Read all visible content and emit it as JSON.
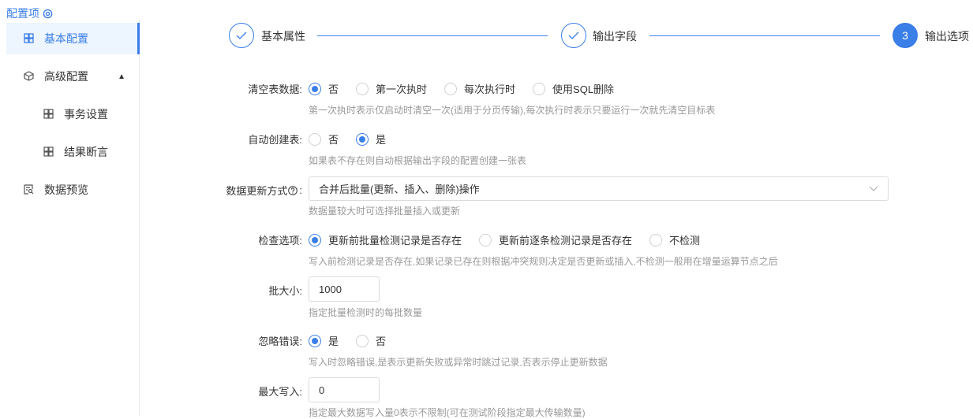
{
  "sidebar": {
    "title": "配置项",
    "items": [
      {
        "label": "基本配置",
        "icon": "grid-icon"
      },
      {
        "label": "高级配置",
        "icon": "cube-icon"
      },
      {
        "label": "事务设置",
        "icon": "grid-icon"
      },
      {
        "label": "结果断言",
        "icon": "grid-icon"
      },
      {
        "label": "数据预览",
        "icon": "preview-icon"
      }
    ]
  },
  "steps": [
    {
      "label": "基本属性",
      "status": "done"
    },
    {
      "label": "输出字段",
      "status": "done"
    },
    {
      "label": "输出选项",
      "number": "3",
      "status": "current"
    }
  ],
  "form": {
    "clear": {
      "label": "清空表数据:",
      "options": [
        "否",
        "第一次执时",
        "每次执行时",
        "使用SQL删除"
      ],
      "selected": 0,
      "hint": "第一次执时表示仅启动时清空一次(适用于分页传输),每次执行时表示只要运行一次就先清空目标表"
    },
    "autocreate": {
      "label": "自动创建表:",
      "options": [
        "否",
        "是"
      ],
      "selected": 1,
      "hint": "如果表不存在则自动根据输出字段的配置创建一张表"
    },
    "update": {
      "label": "数据更新方式",
      "suffix": ":",
      "value": "合并后批量(更新、插入、删除)操作",
      "hint": "数据量较大时可选择批量插入或更新"
    },
    "check": {
      "label": "检查选项:",
      "options": [
        "更新前批量检测记录是否存在",
        "更新前逐条检测记录是否存在",
        "不检测"
      ],
      "selected": 0,
      "hint": "写入前检测记录是否存在,如果记录已存在则根据冲突规则决定是否更新或插入,不检测一般用在增量运算节点之后"
    },
    "batch": {
      "label": "批大小:",
      "value": "1000",
      "hint": "指定批量检测时的每批数量"
    },
    "ignore": {
      "label": "忽略错误:",
      "options": [
        "是",
        "否"
      ],
      "selected": 0,
      "hint": "写入时忽略错误,是表示更新失败或异常时跳过记录,否表示停止更新数据"
    },
    "max": {
      "label": "最大写入:",
      "value": "0",
      "hint": "指定最大数据写入量0表示不限制(可在测试阶段指定最大传输数量)"
    }
  },
  "colors": {
    "accent": "#3a7ee8",
    "hint": "#999999"
  }
}
